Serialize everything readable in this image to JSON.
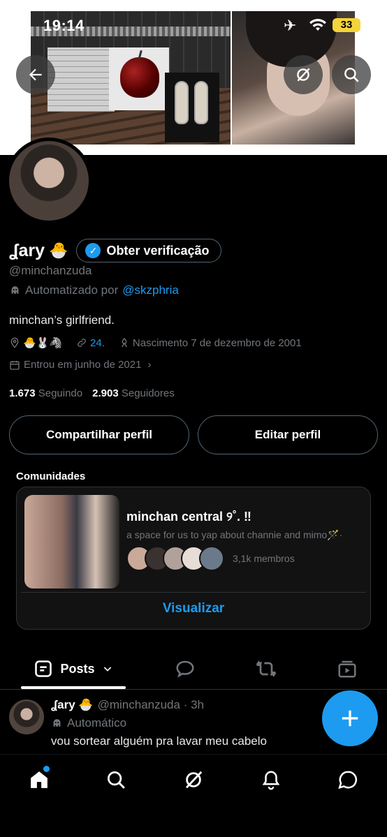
{
  "status_bar": {
    "time": "19:14",
    "battery": "33"
  },
  "profile": {
    "name": "ʆary",
    "name_emoji": "🐣",
    "verify_label": "Obter verificação",
    "handle": "@minchanzuda",
    "automated_prefix": "Automatizado por",
    "automated_by": "@skzphria",
    "bio": "minchan’s girlfriend.",
    "location_emojis": "🐣🐰🦓",
    "website": "24.",
    "birthday": "Nascimento 7 de dezembro de 2001",
    "joined": "Entrou em junho de 2021",
    "following_count": "1.673",
    "following_label": "Seguindo",
    "followers_count": "2.903",
    "followers_label": "Seguidores"
  },
  "buttons": {
    "share": "Compartilhar perfil",
    "edit": "Editar perfil"
  },
  "communities": {
    "title": "Comunidades",
    "name": "minchan central ୨˚. ‼",
    "description": "a space for us to yap about channie and mimo🪄·",
    "members": "3,1k membros",
    "view_label": "Visualizar"
  },
  "tabs": {
    "posts": "Posts"
  },
  "tweet": {
    "name": "ʆary 🐣",
    "handle_time": "@minchanzuda · 3h",
    "automated": "Automático",
    "text": "vou sortear alguém pra lavar meu cabelo"
  },
  "colors": {
    "accent": "#1d9bf0",
    "background": "#000000",
    "muted": "#71767b"
  },
  "icons": [
    "back-arrow-icon",
    "grok-icon",
    "search-icon",
    "chevron-down-icon",
    "reply-icon",
    "repost-icon",
    "media-icon",
    "plus-icon",
    "home-icon",
    "bell-icon",
    "messages-icon"
  ]
}
